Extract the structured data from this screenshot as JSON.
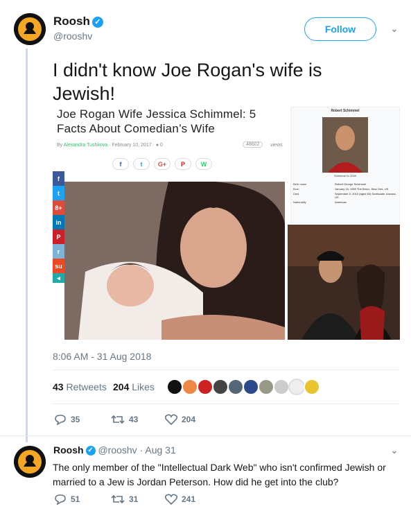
{
  "main_tweet": {
    "author_name": "Roosh",
    "handle": "@rooshv",
    "verified_mark": "✓",
    "follow_label": "Follow",
    "text": "I didn't know Joe Rogan's wife is Jewish!",
    "timestamp": "8:06 AM - 31 Aug 2018",
    "retweets_count": "43",
    "retweets_label": "Retweets",
    "likes_count": "204",
    "likes_label": "Likes",
    "actions": {
      "replies": "35",
      "retweets": "43",
      "likes": "204"
    }
  },
  "article": {
    "title": "Joe Rogan Wife Jessica Schimmel: 5 Facts About Comedian’s Wife",
    "by": "By",
    "author": "Alexandra Tushkova",
    "date": "February 10, 2017",
    "comments": "0",
    "views_count": "48602",
    "views_label": "views",
    "share_buttons": [
      "f",
      "t",
      "G+",
      "P",
      "W"
    ],
    "side_share": [
      "f",
      "t",
      "8+",
      "in",
      "P",
      "r",
      "su"
    ]
  },
  "wiki": {
    "name": "Robert Schimmel",
    "caption": "Schimmel in 2009",
    "rows": [
      {
        "k": "Birth name",
        "v": "Robert George Schimmel"
      },
      {
        "k": "Born",
        "v": "January 16, 1950 The Bronx, New York, US"
      },
      {
        "k": "Died",
        "v": "September 3, 2010 (aged 60) Scottsdale, Arizona, US"
      },
      {
        "k": "Nationality",
        "v": "American"
      }
    ]
  },
  "reply_tweet": {
    "author_name": "Roosh",
    "verified_mark": "✓",
    "handle_date": "@rooshv · Aug 31",
    "text": "The only member of the \"Intellectual Dark Web\" who isn't confirmed Jewish or married to a Jew is Jordan Peterson. How did he get into the club?",
    "actions": {
      "replies": "51",
      "retweets": "31",
      "likes": "241"
    }
  },
  "colors": {
    "accent": "#1da1f2",
    "thread": "#ccd6f6",
    "muted": "#657786"
  }
}
